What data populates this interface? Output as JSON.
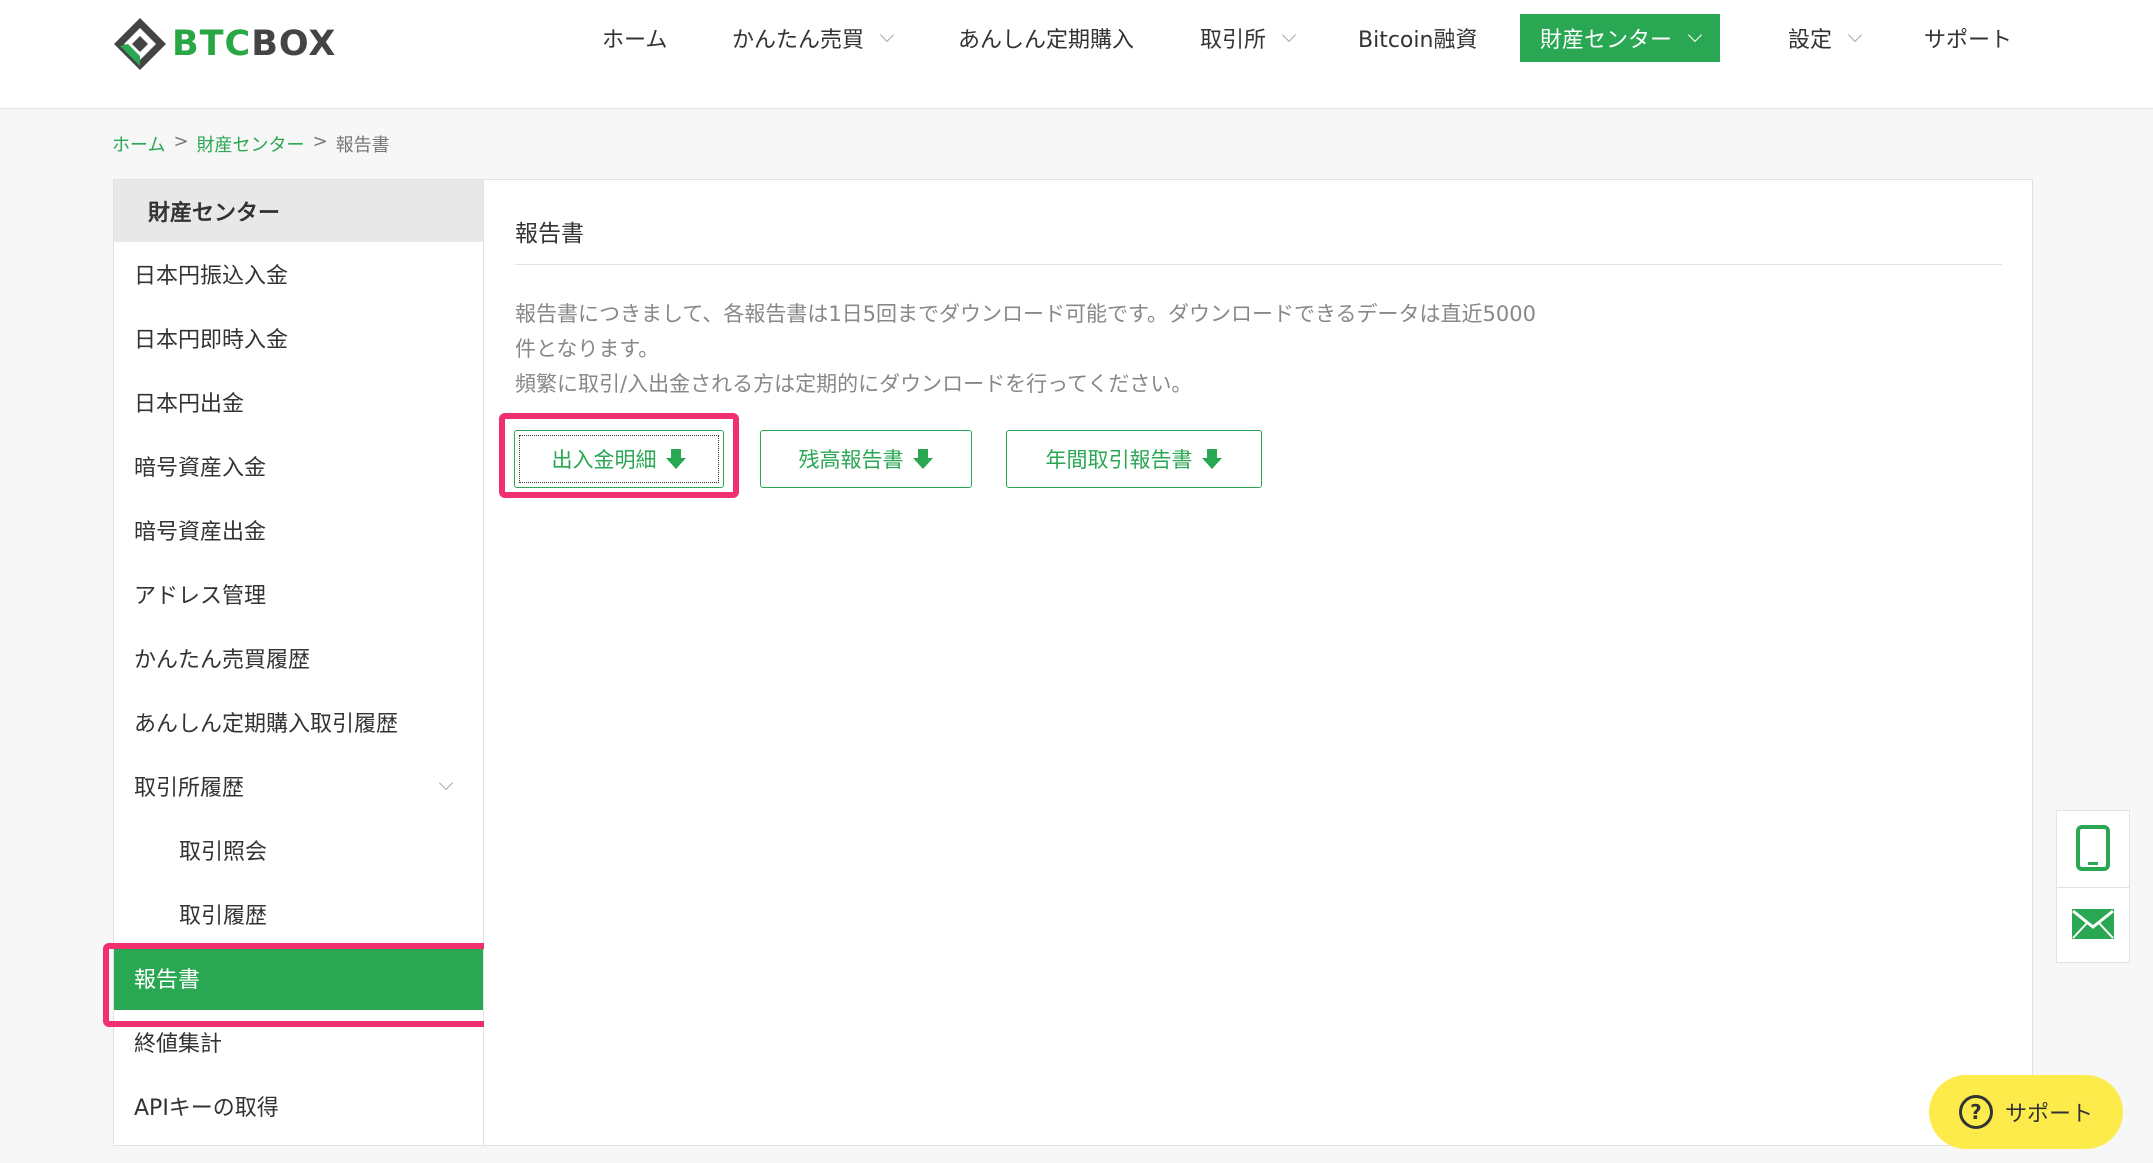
{
  "brand": {
    "logo_text_1": "BTC",
    "logo_text_2": "BOX"
  },
  "nav": {
    "items": [
      {
        "label": "ホーム"
      },
      {
        "label": "かんたん売買"
      },
      {
        "label": "あんしん定期購入"
      },
      {
        "label": "取引所"
      },
      {
        "label": "Bitcoin融資"
      },
      {
        "label": "財産センター"
      },
      {
        "label": "設定"
      },
      {
        "label": "サポート"
      }
    ]
  },
  "breadcrumb": {
    "home": "ホーム",
    "center": "財産センター",
    "current": "報告書",
    "sep": ">"
  },
  "sidebar": {
    "header": "財産センター",
    "items": [
      {
        "label": "日本円振込入金"
      },
      {
        "label": "日本円即時入金"
      },
      {
        "label": "日本円出金"
      },
      {
        "label": "暗号資産入金"
      },
      {
        "label": "暗号資産出金"
      },
      {
        "label": "アドレス管理"
      },
      {
        "label": "かんたん売買履歴"
      },
      {
        "label": "あんしん定期購入取引履歴"
      },
      {
        "label": "取引所履歴"
      },
      {
        "label": "取引照会"
      },
      {
        "label": "取引履歴"
      },
      {
        "label": "報告書"
      },
      {
        "label": "終値集計"
      },
      {
        "label": "APIキーの取得"
      }
    ]
  },
  "main": {
    "title": "報告書",
    "notice_line1": "報告書につきまして、各報告書は1日5回までダウンロード可能です。ダウンロードできるデータは直近5000件となります。",
    "notice_line2": "頻繁に取引/入出金される方は定期的にダウンロードを行ってください。",
    "buttons": {
      "deposit_withdrawal": "出入金明細",
      "balance": "残高報告書",
      "annual": "年間取引報告書"
    }
  },
  "floating": {
    "support_label": "サポート",
    "support_icon": "?"
  },
  "colors": {
    "accent": "#2aa753",
    "highlight": "#f0306f",
    "support_bg": "#fdeb4b"
  }
}
